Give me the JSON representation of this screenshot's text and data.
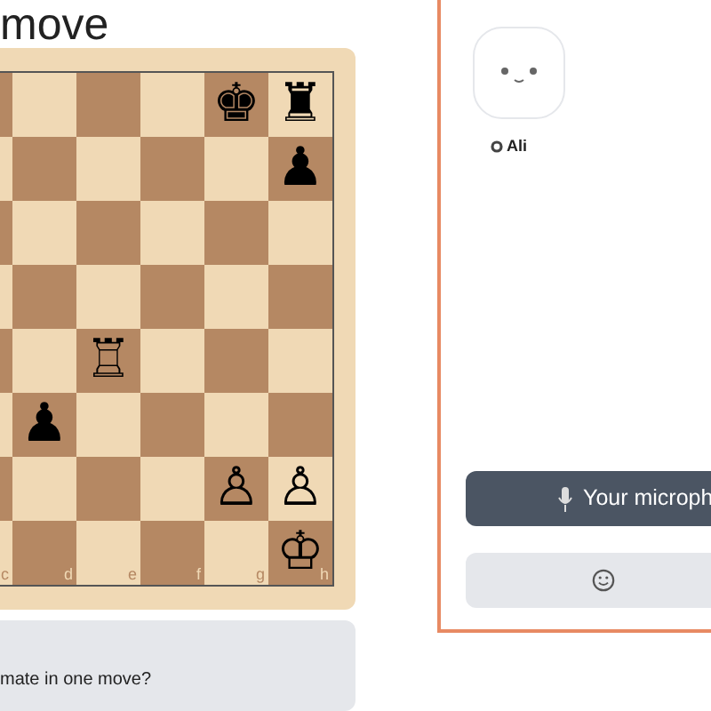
{
  "title": "move",
  "board": {
    "files": [
      "c",
      "d",
      "e",
      "f",
      "g",
      "h"
    ],
    "ranks": [
      [
        {
          "kind": "empty"
        },
        {
          "kind": "empty"
        },
        {
          "kind": "empty"
        },
        {
          "kind": "empty"
        },
        {
          "kind": "piece",
          "glyph": "♚"
        },
        {
          "kind": "piece",
          "glyph": "♜"
        }
      ],
      [
        {
          "kind": "empty"
        },
        {
          "kind": "empty"
        },
        {
          "kind": "empty"
        },
        {
          "kind": "empty"
        },
        {
          "kind": "empty"
        },
        {
          "kind": "piece",
          "glyph": "♟"
        }
      ],
      [
        {
          "kind": "empty"
        },
        {
          "kind": "empty"
        },
        {
          "kind": "empty"
        },
        {
          "kind": "empty"
        },
        {
          "kind": "empty"
        },
        {
          "kind": "empty"
        }
      ],
      [
        {
          "kind": "empty"
        },
        {
          "kind": "empty"
        },
        {
          "kind": "empty"
        },
        {
          "kind": "empty"
        },
        {
          "kind": "empty"
        },
        {
          "kind": "empty"
        }
      ],
      [
        {
          "kind": "empty"
        },
        {
          "kind": "empty"
        },
        {
          "kind": "piece",
          "glyph": "♖"
        },
        {
          "kind": "empty"
        },
        {
          "kind": "empty"
        },
        {
          "kind": "empty"
        }
      ],
      [
        {
          "kind": "empty"
        },
        {
          "kind": "piece",
          "glyph": "♟"
        },
        {
          "kind": "empty"
        },
        {
          "kind": "empty"
        },
        {
          "kind": "empty"
        },
        {
          "kind": "empty"
        }
      ],
      [
        {
          "kind": "empty"
        },
        {
          "kind": "empty"
        },
        {
          "kind": "empty"
        },
        {
          "kind": "empty"
        },
        {
          "kind": "piece",
          "glyph": "♙"
        },
        {
          "kind": "piece",
          "glyph": "♙"
        }
      ],
      [
        {
          "kind": "empty"
        },
        {
          "kind": "empty"
        },
        {
          "kind": "empty"
        },
        {
          "kind": "empty"
        },
        {
          "kind": "empty"
        },
        {
          "kind": "piece",
          "glyph": "♔"
        }
      ]
    ]
  },
  "question": "mate in one move?",
  "participants": [
    {
      "name": "Ali"
    }
  ],
  "mic_button": {
    "label": "Your microph"
  }
}
